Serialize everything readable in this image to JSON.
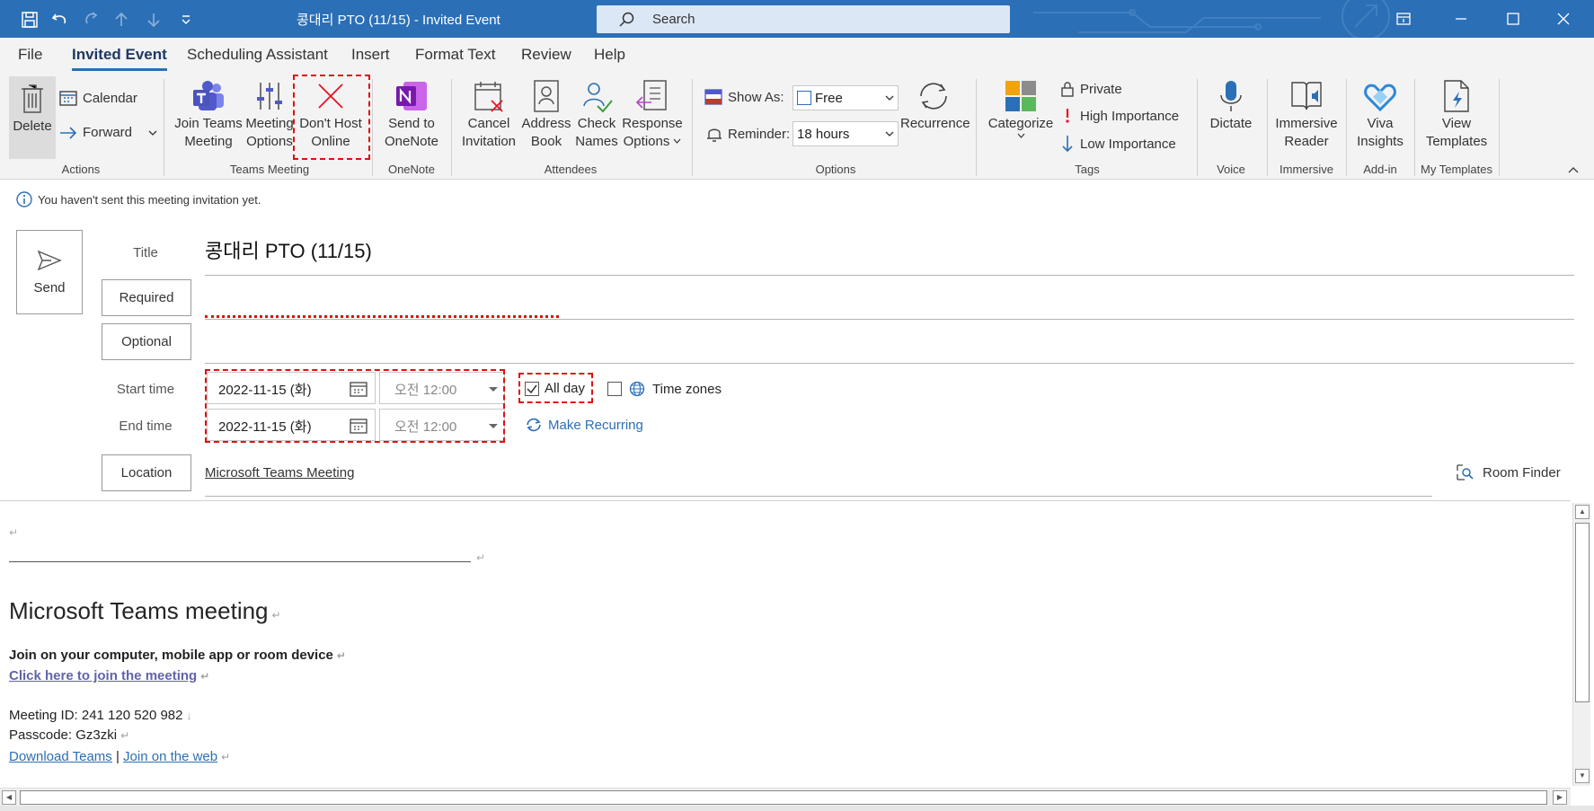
{
  "window": {
    "title": "콩대리 PTO (11/15)  -  Invited Event",
    "search_placeholder": "Search"
  },
  "menu": [
    "File",
    "Invited Event",
    "Scheduling Assistant",
    "Insert",
    "Format Text",
    "Review",
    "Help"
  ],
  "ribbon": {
    "actions": {
      "delete": "Delete",
      "calendar": "Calendar",
      "forward": "Forward",
      "group": "Actions"
    },
    "teams": {
      "join_l1": "Join Teams",
      "join_l2": "Meeting",
      "options_l1": "Meeting",
      "options_l2": "Options",
      "dont_host_l1": "Don't Host",
      "dont_host_l2": "Online",
      "group": "Teams Meeting"
    },
    "onenote": {
      "send_l1": "Send to",
      "send_l2": "OneNote",
      "group": "OneNote"
    },
    "attendees": {
      "cancel_l1": "Cancel",
      "cancel_l2": "Invitation",
      "address_l1": "Address",
      "address_l2": "Book",
      "check_l1": "Check",
      "check_l2": "Names",
      "response_l1": "Response",
      "response_l2": "Options",
      "group": "Attendees"
    },
    "options": {
      "show_as_label": "Show As:",
      "show_as_value": "Free",
      "reminder_label": "Reminder:",
      "reminder_value": "18 hours",
      "recurrence": "Recurrence",
      "group": "Options"
    },
    "tags": {
      "categorize": "Categorize",
      "private": "Private",
      "high": "High Importance",
      "low": "Low Importance",
      "group": "Tags"
    },
    "voice": {
      "dictate": "Dictate",
      "group": "Voice"
    },
    "immersive": {
      "l1": "Immersive",
      "l2": "Reader",
      "group": "Immersive"
    },
    "addin": {
      "l1": "Viva",
      "l2": "Insights",
      "group": "Add-in"
    },
    "templates": {
      "l1": "View",
      "l2": "Templates",
      "group": "My Templates"
    }
  },
  "info_bar": "You haven't sent this meeting invitation yet.",
  "form": {
    "send": "Send",
    "title_label": "Title",
    "title_value": "콩대리 PTO (11/15)",
    "required": "Required",
    "optional": "Optional",
    "start_label": "Start time",
    "end_label": "End time",
    "start_date": "2022-11-15 (화)",
    "start_time": "오전 12:00",
    "end_date": "2022-11-15 (화)",
    "end_time": "오전 12:00",
    "all_day": "All day",
    "all_day_checked": true,
    "time_zones": "Time zones",
    "make_recurring": "Make Recurring",
    "location_btn": "Location",
    "location_value": "Microsoft Teams Meeting",
    "room_finder": "Room Finder"
  },
  "body": {
    "heading": "Microsoft Teams meeting",
    "join_text": "Join on your computer, mobile app or room device",
    "join_link": "Click here to join the meeting",
    "meeting_id": "Meeting ID: 241 120 520 982",
    "passcode": "Passcode: Gz3zki",
    "download": "Download Teams",
    "separator": "|",
    "web": "Join on the web"
  },
  "colors": {
    "accent": "#2b6fb6",
    "annotation": "#e01010",
    "teams_purple": "#5059c9",
    "onenote_purple": "#7719aa"
  }
}
